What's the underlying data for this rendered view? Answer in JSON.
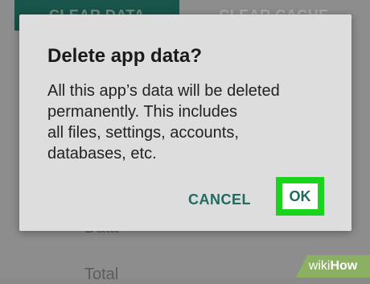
{
  "background": {
    "clear_data_label": "CLEAR DATA",
    "clear_cache_label": "CLEAR CACHE",
    "data_label": "Data",
    "total_label": "Total"
  },
  "dialog": {
    "title": "Delete app data?",
    "message_lines": [
      "All this app’s data will be deleted",
      "permanently. This includes",
      "all files, settings, accounts,",
      "databases, etc."
    ],
    "cancel_label": "CANCEL",
    "ok_label": "OK"
  },
  "watermark": {
    "prefix": "wiki",
    "suffix": "How"
  },
  "colors": {
    "accent": "#1e6c5f",
    "highlight": "#19d41b",
    "dialog_bg": "#dddddd",
    "watermark_bg": "#8bb062"
  }
}
